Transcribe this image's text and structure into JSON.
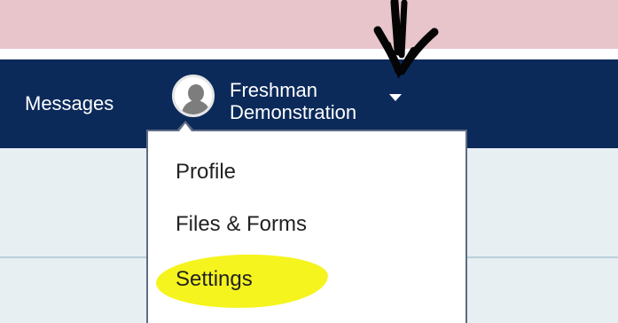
{
  "navbar": {
    "messages_label": "Messages",
    "user_name_line1": "Freshman",
    "user_name_line2": "Demonstration"
  },
  "dropdown": {
    "items": [
      {
        "label": "Profile"
      },
      {
        "label": "Files & Forms"
      },
      {
        "label": "Settings"
      }
    ]
  },
  "icons": {
    "avatar": "user-avatar-icon",
    "caret": "chevron-down-icon",
    "annotation": "pointing-arrow-icon"
  },
  "colors": {
    "navbar": "#0b2a5a",
    "top_strip": "#e7c5cb",
    "highlight": "#f5f41e",
    "content_bg": "#e8eff2"
  }
}
